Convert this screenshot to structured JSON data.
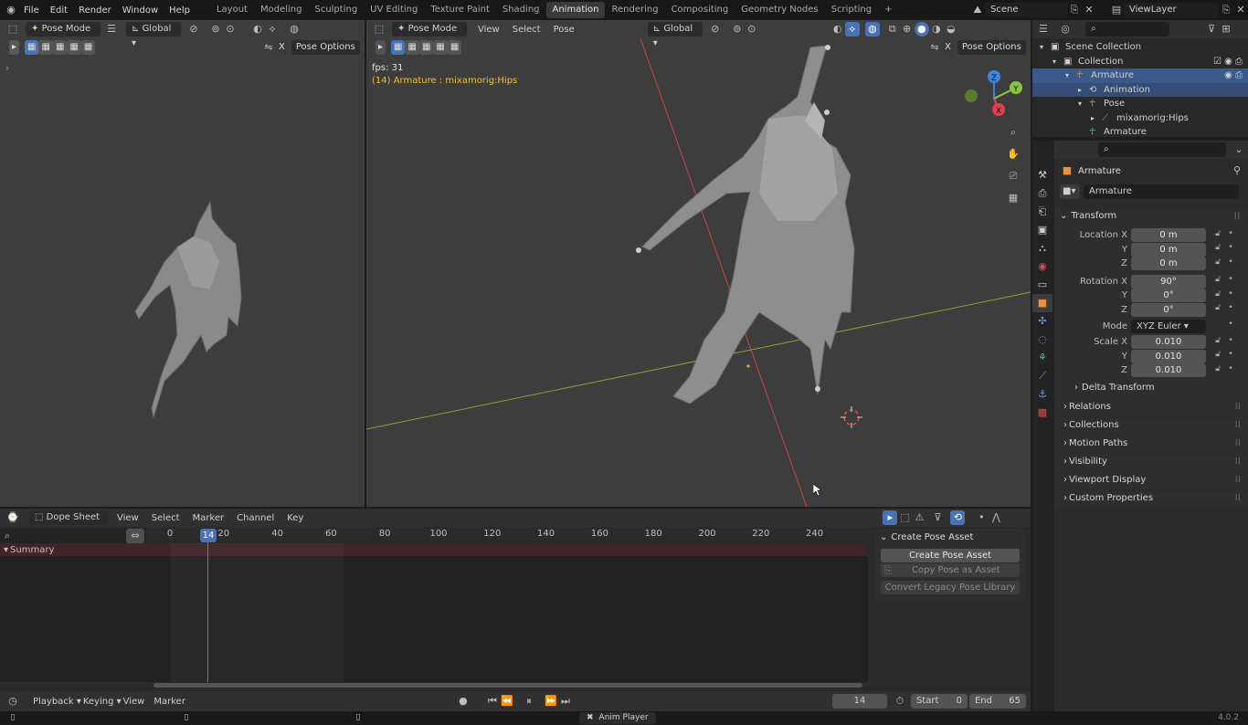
{
  "menubar": {
    "menus": [
      "File",
      "Edit",
      "Render",
      "Window",
      "Help"
    ],
    "workspaces": [
      "Layout",
      "Modeling",
      "Sculpting",
      "UV Editing",
      "Texture Paint",
      "Shading",
      "Animation",
      "Rendering",
      "Compositing",
      "Geometry Nodes",
      "Scripting"
    ],
    "active_workspace": "Animation",
    "scene": "Scene",
    "view_layer": "ViewLayer"
  },
  "left_viewport": {
    "mode": "Pose Mode",
    "orientation": "Global",
    "pose_options": "Pose Options"
  },
  "main_viewport": {
    "mode": "Pose Mode",
    "menus": [
      "View",
      "Select",
      "Pose"
    ],
    "orientation": "Global",
    "pose_options": "Pose Options",
    "fps": "fps: 31",
    "active_info": "(14) Armature : mixamorig:Hips",
    "gizmo_axes": {
      "z": "Z",
      "y": "Y",
      "x": "X"
    }
  },
  "outliner": {
    "items": [
      {
        "label": "Scene Collection",
        "indent": 0
      },
      {
        "label": "Collection",
        "indent": 1
      },
      {
        "label": "Armature",
        "indent": 2,
        "selected": true
      },
      {
        "label": "Animation",
        "indent": 3,
        "selected": true
      },
      {
        "label": "Pose",
        "indent": 3
      },
      {
        "label": "mixamorig:Hips",
        "indent": 4
      },
      {
        "label": "Armature",
        "indent": 3
      }
    ]
  },
  "properties": {
    "object_name": "Armature",
    "data_name": "Armature",
    "transform_title": "Transform",
    "location": {
      "label": "Location X",
      "x": "0 m",
      "y": "0 m",
      "z": "0 m"
    },
    "rotation": {
      "label": "Rotation X",
      "x": "90°",
      "y": "0°",
      "z": "0°"
    },
    "mode_label": "Mode",
    "mode_value": "XYZ Euler",
    "scale": {
      "label": "Scale X",
      "x": "0.010",
      "y": "0.010",
      "z": "0.010"
    },
    "axis_y": "Y",
    "axis_z": "Z",
    "delta_transform": "Delta Transform",
    "panels": [
      "Relations",
      "Collections",
      "Motion Paths",
      "Visibility",
      "Viewport Display",
      "Custom Properties"
    ]
  },
  "dopesheet": {
    "editor": "Dope Sheet",
    "menus": [
      "View",
      "Select",
      "Marker",
      "Channel",
      "Key"
    ],
    "ticks": [
      "0",
      "20",
      "40",
      "60",
      "80",
      "100",
      "120",
      "140",
      "160",
      "180",
      "200",
      "220",
      "240"
    ],
    "current_frame_badge": "14",
    "summary": "Summary",
    "pose_asset_panel": {
      "title": "Create Pose Asset",
      "create": "Create Pose Asset",
      "copy": "Copy Pose as Asset",
      "convert": "Convert Legacy Pose Library"
    }
  },
  "timeline": {
    "menus": [
      "Playback",
      "Keying",
      "View",
      "Marker"
    ],
    "current_frame": "14",
    "start_label": "Start",
    "start": "0",
    "end_label": "End",
    "end": "65"
  },
  "statusbar": {
    "center": "Anim Player",
    "version": "4.0.2"
  },
  "colors": {
    "accent_blue": "#4772b3",
    "x_axis": "#c9444d",
    "y_axis": "#8aa232",
    "active_yellow": "#e8c040",
    "gizmo_x": "#e0434f",
    "gizmo_y": "#8cc63f",
    "gizmo_z": "#3b86e3"
  }
}
